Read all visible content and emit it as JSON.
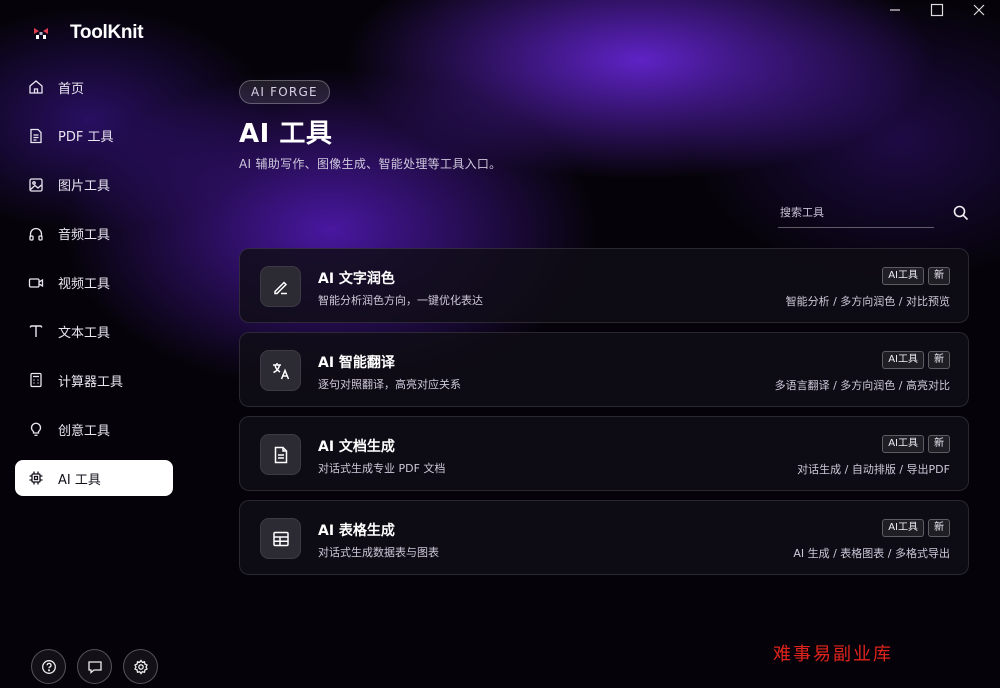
{
  "app": {
    "name": "ToolKnit"
  },
  "sidebar": {
    "items": [
      {
        "label": "首页",
        "icon": "home-icon"
      },
      {
        "label": "PDF 工具",
        "icon": "pdf-icon"
      },
      {
        "label": "图片工具",
        "icon": "image-icon"
      },
      {
        "label": "音频工具",
        "icon": "headphones-icon"
      },
      {
        "label": "视频工具",
        "icon": "video-icon"
      },
      {
        "label": "文本工具",
        "icon": "text-icon"
      },
      {
        "label": "计算器工具",
        "icon": "calculator-icon"
      },
      {
        "label": "创意工具",
        "icon": "lightbulb-icon"
      },
      {
        "label": "AI 工具",
        "icon": "chip-icon",
        "active": true
      }
    ],
    "bottom_buttons": [
      "help-icon",
      "chat-icon",
      "settings-icon"
    ]
  },
  "header": {
    "pill": "AI FORGE",
    "title": "AI 工具",
    "subtitle": "AI 辅助写作、图像生成、智能处理等工具入口。"
  },
  "search": {
    "placeholder": "搜索工具"
  },
  "cards": [
    {
      "title": "AI 文字润色",
      "desc": "智能分析润色方向，一键优化表达",
      "badge_type": "AI工具",
      "badge_new": "新",
      "tags": "智能分析 / 多方向润色 / 对比预览",
      "icon": "pencil-icon"
    },
    {
      "title": "AI 智能翻译",
      "desc": "逐句对照翻译，高亮对应关系",
      "badge_type": "AI工具",
      "badge_new": "新",
      "tags": "多语言翻译 / 多方向润色 / 高亮对比",
      "icon": "translate-icon"
    },
    {
      "title": "AI 文档生成",
      "desc": "对话式生成专业 PDF 文档",
      "badge_type": "AI工具",
      "badge_new": "新",
      "tags": "对话生成 / 自动排版 / 导出PDF",
      "icon": "document-icon"
    },
    {
      "title": "AI 表格生成",
      "desc": "对话式生成数据表与图表",
      "badge_type": "AI工具",
      "badge_new": "新",
      "tags": "AI 生成 / 表格图表 / 多格式导出",
      "icon": "table-icon"
    }
  ],
  "watermark": "难事易副业库",
  "colors": {
    "background": "#050309",
    "accent": "#6a28e6",
    "watermark": "#e0231c"
  }
}
